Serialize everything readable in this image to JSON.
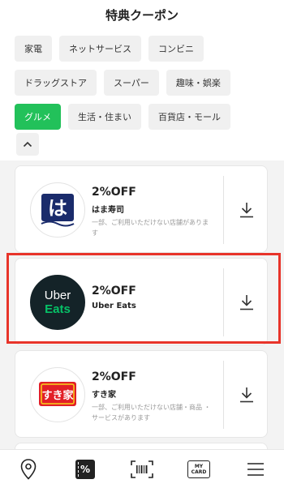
{
  "header": {
    "title": "特典クーポン"
  },
  "categories": {
    "rows": [
      [
        {
          "label": "家電",
          "active": false
        },
        {
          "label": "ネットサービス",
          "active": false
        },
        {
          "label": "コンビニ",
          "active": false
        }
      ],
      [
        {
          "label": "ドラッグストア",
          "active": false
        },
        {
          "label": "スーパー",
          "active": false
        },
        {
          "label": "趣味・娯楽",
          "active": false
        }
      ],
      [
        {
          "label": "グルメ",
          "active": true
        },
        {
          "label": "生活・住まい",
          "active": false
        },
        {
          "label": "百貨店・モール",
          "active": false
        }
      ]
    ],
    "collapse_icon": "chevron-up-icon"
  },
  "coupons": [
    {
      "discount": "2%OFF",
      "name": "はま寿司",
      "note": "一部、ご利用いただけない店舗がありま す",
      "logo_icon": "hamazushi-logo",
      "logo_bg": "#ffffff",
      "logo_text": "は",
      "download_icon": "download-icon"
    },
    {
      "discount": "2%OFF",
      "name": "Uber Eats",
      "note": "",
      "logo_icon": "ubereats-logo",
      "logo_bg": "#142328",
      "logo_text_1": "Uber",
      "logo_text_2": "Eats",
      "download_icon": "download-icon"
    },
    {
      "discount": "2%OFF",
      "name": "すき家",
      "note": "一部、ご利用いただけない店舗・商品 ・サービスがあります",
      "logo_icon": "sukiya-logo",
      "logo_bg": "#e21f26",
      "logo_text": "すき家",
      "download_icon": "download-icon"
    }
  ],
  "bottom_nav": {
    "items": [
      {
        "icon": "location-pin-icon"
      },
      {
        "icon": "coupon-percent-icon",
        "label": "%"
      },
      {
        "icon": "barcode-icon"
      },
      {
        "icon": "my-card-icon",
        "label_1": "MY",
        "label_2": "CARD"
      },
      {
        "icon": "menu-icon"
      }
    ]
  },
  "colors": {
    "accent_green": "#22c15a",
    "highlight_red": "#e8342a",
    "chip_bg": "#f0f0f0",
    "uber_green": "#06c167"
  }
}
